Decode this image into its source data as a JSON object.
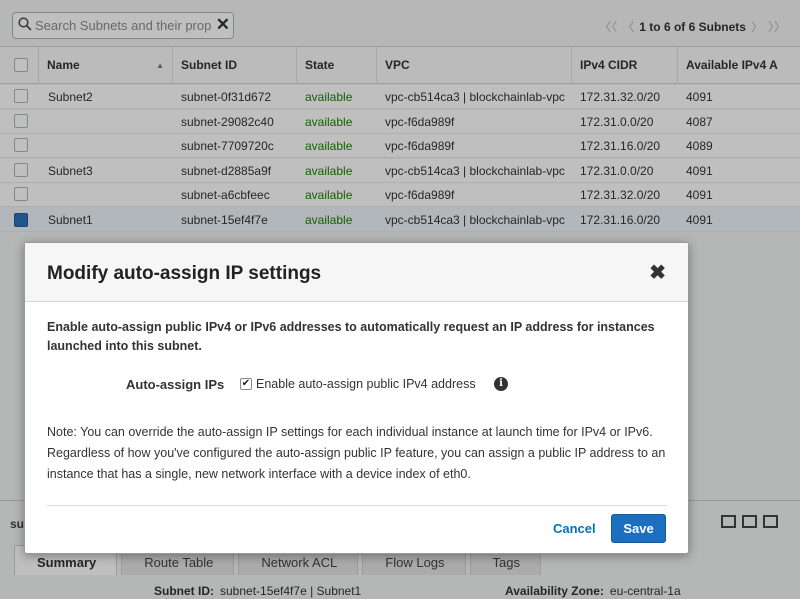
{
  "toolbar": {
    "search_placeholder": "Search Subnets and their prop",
    "clear_icon": "✕",
    "pager_text": "1 to 6 of 6 Subnets",
    "first_icon": "〈〈",
    "prev_icon": "〈",
    "next_icon": "〉",
    "last_icon": "〉〉"
  },
  "table": {
    "columns": [
      "Name",
      "Subnet ID",
      "State",
      "VPC",
      "IPv4 CIDR",
      "Available IPv4 A"
    ],
    "sort_icon": "▲",
    "rows": [
      {
        "name": "Subnet2",
        "subnet_id": "subnet-0f31d672",
        "state": "available",
        "vpc": "vpc-cb514ca3 | blockchainlab-vpc",
        "cidr": "172.31.32.0/20",
        "avail": "4091",
        "selected": false
      },
      {
        "name": "",
        "subnet_id": "subnet-29082c40",
        "state": "available",
        "vpc": "vpc-f6da989f",
        "cidr": "172.31.0.0/20",
        "avail": "4087",
        "selected": false
      },
      {
        "name": "",
        "subnet_id": "subnet-7709720c",
        "state": "available",
        "vpc": "vpc-f6da989f",
        "cidr": "172.31.16.0/20",
        "avail": "4089",
        "selected": false
      },
      {
        "name": "Subnet3",
        "subnet_id": "subnet-d2885a9f",
        "state": "available",
        "vpc": "vpc-cb514ca3 | blockchainlab-vpc",
        "cidr": "172.31.0.0/20",
        "avail": "4091",
        "selected": false
      },
      {
        "name": "",
        "subnet_id": "subnet-a6cbfeec",
        "state": "available",
        "vpc": "vpc-f6da989f",
        "cidr": "172.31.32.0/20",
        "avail": "4091",
        "selected": false
      },
      {
        "name": "Subnet1",
        "subnet_id": "subnet-15ef4f7e",
        "state": "available",
        "vpc": "vpc-cb514ca3 | blockchainlab-vpc",
        "cidr": "172.31.16.0/20",
        "avail": "4091",
        "selected": true
      }
    ]
  },
  "bottom": {
    "label": "su",
    "tabs": [
      "Summary",
      "Route Table",
      "Network ACL",
      "Flow Logs",
      "Tags"
    ],
    "subnet_id_label": "Subnet ID:",
    "subnet_id_value": "subnet-15ef4f7e | Subnet1",
    "az_label": "Availability Zone:",
    "az_value": "eu-central-1a"
  },
  "modal": {
    "title": "Modify auto-assign IP settings",
    "close_icon": "✖",
    "intro": "Enable auto-assign public IPv4 or IPv6 addresses to automatically request an IP address for instances launched into this subnet.",
    "auto_assign_label": "Auto-assign IPs",
    "checkbox_mark": "✔",
    "checkbox_label": "Enable auto-assign public IPv4 address",
    "info_icon": "i",
    "note": "Note: You can override the auto-assign IP settings for each individual instance at launch time for IPv4 or IPv6. Regardless of how you've configured the auto-assign public IP feature, you can assign a public IP address to an instance that has a single, new network interface with a device index of eth0.",
    "cancel_label": "Cancel",
    "save_label": "Save"
  },
  "colors": {
    "accent": "#1a6fc0",
    "link": "#0073bb",
    "available": "#1d8102"
  }
}
